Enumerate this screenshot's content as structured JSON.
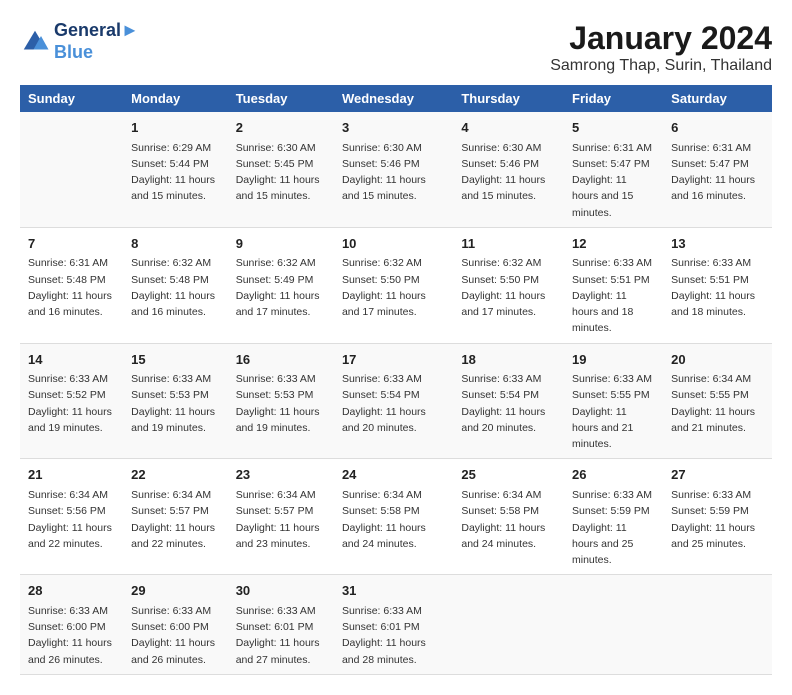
{
  "header": {
    "logo_line1": "General",
    "logo_line2": "Blue",
    "main_title": "January 2024",
    "subtitle": "Samrong Thap, Surin, Thailand"
  },
  "columns": [
    "Sunday",
    "Monday",
    "Tuesday",
    "Wednesday",
    "Thursday",
    "Friday",
    "Saturday"
  ],
  "weeks": [
    [
      {
        "day": "",
        "sunrise": "",
        "sunset": "",
        "daylight": ""
      },
      {
        "day": "1",
        "sunrise": "Sunrise: 6:29 AM",
        "sunset": "Sunset: 5:44 PM",
        "daylight": "Daylight: 11 hours and 15 minutes."
      },
      {
        "day": "2",
        "sunrise": "Sunrise: 6:30 AM",
        "sunset": "Sunset: 5:45 PM",
        "daylight": "Daylight: 11 hours and 15 minutes."
      },
      {
        "day": "3",
        "sunrise": "Sunrise: 6:30 AM",
        "sunset": "Sunset: 5:46 PM",
        "daylight": "Daylight: 11 hours and 15 minutes."
      },
      {
        "day": "4",
        "sunrise": "Sunrise: 6:30 AM",
        "sunset": "Sunset: 5:46 PM",
        "daylight": "Daylight: 11 hours and 15 minutes."
      },
      {
        "day": "5",
        "sunrise": "Sunrise: 6:31 AM",
        "sunset": "Sunset: 5:47 PM",
        "daylight": "Daylight: 11 hours and 15 minutes."
      },
      {
        "day": "6",
        "sunrise": "Sunrise: 6:31 AM",
        "sunset": "Sunset: 5:47 PM",
        "daylight": "Daylight: 11 hours and 16 minutes."
      }
    ],
    [
      {
        "day": "7",
        "sunrise": "Sunrise: 6:31 AM",
        "sunset": "Sunset: 5:48 PM",
        "daylight": "Daylight: 11 hours and 16 minutes."
      },
      {
        "day": "8",
        "sunrise": "Sunrise: 6:32 AM",
        "sunset": "Sunset: 5:48 PM",
        "daylight": "Daylight: 11 hours and 16 minutes."
      },
      {
        "day": "9",
        "sunrise": "Sunrise: 6:32 AM",
        "sunset": "Sunset: 5:49 PM",
        "daylight": "Daylight: 11 hours and 17 minutes."
      },
      {
        "day": "10",
        "sunrise": "Sunrise: 6:32 AM",
        "sunset": "Sunset: 5:50 PM",
        "daylight": "Daylight: 11 hours and 17 minutes."
      },
      {
        "day": "11",
        "sunrise": "Sunrise: 6:32 AM",
        "sunset": "Sunset: 5:50 PM",
        "daylight": "Daylight: 11 hours and 17 minutes."
      },
      {
        "day": "12",
        "sunrise": "Sunrise: 6:33 AM",
        "sunset": "Sunset: 5:51 PM",
        "daylight": "Daylight: 11 hours and 18 minutes."
      },
      {
        "day": "13",
        "sunrise": "Sunrise: 6:33 AM",
        "sunset": "Sunset: 5:51 PM",
        "daylight": "Daylight: 11 hours and 18 minutes."
      }
    ],
    [
      {
        "day": "14",
        "sunrise": "Sunrise: 6:33 AM",
        "sunset": "Sunset: 5:52 PM",
        "daylight": "Daylight: 11 hours and 19 minutes."
      },
      {
        "day": "15",
        "sunrise": "Sunrise: 6:33 AM",
        "sunset": "Sunset: 5:53 PM",
        "daylight": "Daylight: 11 hours and 19 minutes."
      },
      {
        "day": "16",
        "sunrise": "Sunrise: 6:33 AM",
        "sunset": "Sunset: 5:53 PM",
        "daylight": "Daylight: 11 hours and 19 minutes."
      },
      {
        "day": "17",
        "sunrise": "Sunrise: 6:33 AM",
        "sunset": "Sunset: 5:54 PM",
        "daylight": "Daylight: 11 hours and 20 minutes."
      },
      {
        "day": "18",
        "sunrise": "Sunrise: 6:33 AM",
        "sunset": "Sunset: 5:54 PM",
        "daylight": "Daylight: 11 hours and 20 minutes."
      },
      {
        "day": "19",
        "sunrise": "Sunrise: 6:33 AM",
        "sunset": "Sunset: 5:55 PM",
        "daylight": "Daylight: 11 hours and 21 minutes."
      },
      {
        "day": "20",
        "sunrise": "Sunrise: 6:34 AM",
        "sunset": "Sunset: 5:55 PM",
        "daylight": "Daylight: 11 hours and 21 minutes."
      }
    ],
    [
      {
        "day": "21",
        "sunrise": "Sunrise: 6:34 AM",
        "sunset": "Sunset: 5:56 PM",
        "daylight": "Daylight: 11 hours and 22 minutes."
      },
      {
        "day": "22",
        "sunrise": "Sunrise: 6:34 AM",
        "sunset": "Sunset: 5:57 PM",
        "daylight": "Daylight: 11 hours and 22 minutes."
      },
      {
        "day": "23",
        "sunrise": "Sunrise: 6:34 AM",
        "sunset": "Sunset: 5:57 PM",
        "daylight": "Daylight: 11 hours and 23 minutes."
      },
      {
        "day": "24",
        "sunrise": "Sunrise: 6:34 AM",
        "sunset": "Sunset: 5:58 PM",
        "daylight": "Daylight: 11 hours and 24 minutes."
      },
      {
        "day": "25",
        "sunrise": "Sunrise: 6:34 AM",
        "sunset": "Sunset: 5:58 PM",
        "daylight": "Daylight: 11 hours and 24 minutes."
      },
      {
        "day": "26",
        "sunrise": "Sunrise: 6:33 AM",
        "sunset": "Sunset: 5:59 PM",
        "daylight": "Daylight: 11 hours and 25 minutes."
      },
      {
        "day": "27",
        "sunrise": "Sunrise: 6:33 AM",
        "sunset": "Sunset: 5:59 PM",
        "daylight": "Daylight: 11 hours and 25 minutes."
      }
    ],
    [
      {
        "day": "28",
        "sunrise": "Sunrise: 6:33 AM",
        "sunset": "Sunset: 6:00 PM",
        "daylight": "Daylight: 11 hours and 26 minutes."
      },
      {
        "day": "29",
        "sunrise": "Sunrise: 6:33 AM",
        "sunset": "Sunset: 6:00 PM",
        "daylight": "Daylight: 11 hours and 26 minutes."
      },
      {
        "day": "30",
        "sunrise": "Sunrise: 6:33 AM",
        "sunset": "Sunset: 6:01 PM",
        "daylight": "Daylight: 11 hours and 27 minutes."
      },
      {
        "day": "31",
        "sunrise": "Sunrise: 6:33 AM",
        "sunset": "Sunset: 6:01 PM",
        "daylight": "Daylight: 11 hours and 28 minutes."
      },
      {
        "day": "",
        "sunrise": "",
        "sunset": "",
        "daylight": ""
      },
      {
        "day": "",
        "sunrise": "",
        "sunset": "",
        "daylight": ""
      },
      {
        "day": "",
        "sunrise": "",
        "sunset": "",
        "daylight": ""
      }
    ]
  ]
}
